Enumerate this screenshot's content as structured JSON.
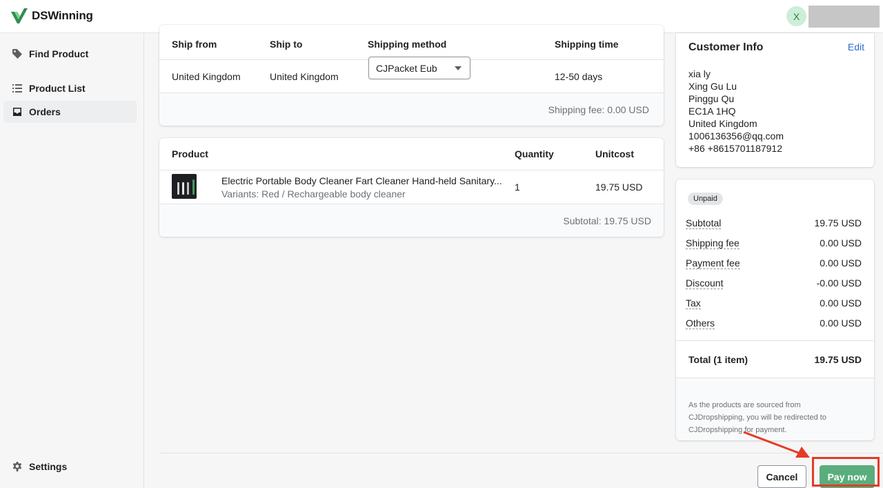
{
  "app": {
    "brand": "DSWinning",
    "user_initial": "X"
  },
  "sidebar": {
    "items": [
      {
        "label": "Find Product",
        "icon": "tag-icon"
      },
      {
        "label": "Product List",
        "icon": "list-icon"
      },
      {
        "label": "Orders",
        "icon": "inbox-icon",
        "active": true
      }
    ],
    "settings_label": "Settings"
  },
  "shipping": {
    "headers": {
      "from": "Ship from",
      "to": "Ship to",
      "method": "Shipping method",
      "time": "Shipping time"
    },
    "from": "United Kingdom",
    "to": "United Kingdom",
    "method": "CJPacket Eub",
    "time": "12-50 days",
    "fee": "Shipping fee: 0.00 USD"
  },
  "products": {
    "headers": {
      "product": "Product",
      "quantity": "Quantity",
      "unitcost": "Unitcost"
    },
    "items": [
      {
        "title": "Electric Portable Body Cleaner Fart Cleaner Hand-held Sanitary...",
        "variants": "Variants: Red / Rechargeable body cleaner",
        "quantity": "1",
        "unitcost": "19.75 USD"
      }
    ],
    "subtotal": "Subtotal: 19.75 USD"
  },
  "customer": {
    "title": "Customer Info",
    "edit_label": "Edit",
    "lines": [
      "xia ly",
      "Xing Gu Lu",
      "Pinggu Qu",
      "EC1A 1HQ",
      "United Kingdom",
      "1006136356@qq.com",
      "+86 +8615701187912"
    ]
  },
  "summary": {
    "status": "Unpaid",
    "rows": [
      {
        "label": "Subtotal",
        "value": "19.75 USD"
      },
      {
        "label": "Shipping fee",
        "value": "0.00 USD"
      },
      {
        "label": "Payment fee",
        "value": "0.00 USD"
      },
      {
        "label": "Discount",
        "value": "-0.00 USD"
      },
      {
        "label": "Tax",
        "value": "0.00 USD"
      },
      {
        "label": "Others",
        "value": "0.00 USD"
      }
    ],
    "total_label": "Total (1 item)",
    "total_value": "19.75 USD",
    "note": "As the products are sourced from CJDropshipping, you will be redirected to CJDropshipping for payment."
  },
  "footer": {
    "cancel_label": "Cancel",
    "pay_label": "Pay now"
  },
  "colors": {
    "brand_green": "#5aad7c",
    "link_blue": "#2c6ecb",
    "annotation_red": "#e53a26"
  }
}
